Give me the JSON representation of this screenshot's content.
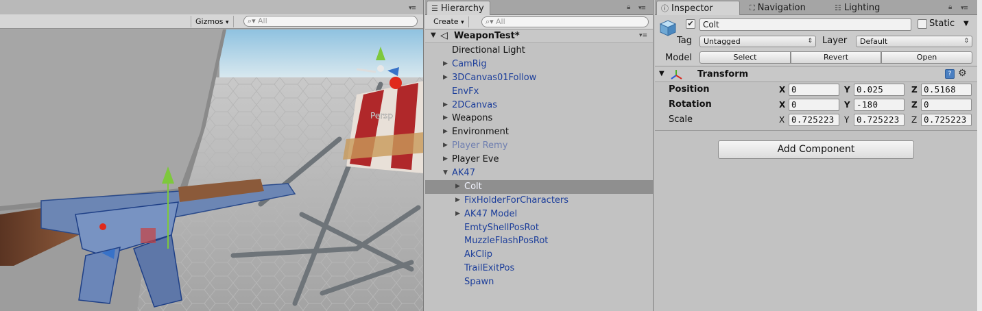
{
  "colors": {
    "panel_bg": "#c2c2c2",
    "selection": "#8f8f8f",
    "prefab_blue": "#1b3d9a",
    "disabled_prefab": "#6f7fb0"
  },
  "scene": {
    "gizmos_label": "Gizmos",
    "search_placeholder": "All",
    "camera_mode": "Persp"
  },
  "hierarchy": {
    "tab_label": "Hierarchy",
    "create_label": "Create",
    "search_placeholder": "All",
    "scene_name": "WeaponTest*",
    "items": [
      {
        "label": "Directional Light",
        "depth": 0,
        "fold": "none",
        "style": "normal"
      },
      {
        "label": "CamRig",
        "depth": 0,
        "fold": "collapsed",
        "style": "prefab"
      },
      {
        "label": "3DCanvas01Follow",
        "depth": 0,
        "fold": "collapsed",
        "style": "prefab"
      },
      {
        "label": "EnvFx",
        "depth": 0,
        "fold": "none",
        "style": "prefab"
      },
      {
        "label": "2DCanvas",
        "depth": 0,
        "fold": "collapsed",
        "style": "prefab"
      },
      {
        "label": "Weapons",
        "depth": 0,
        "fold": "collapsed",
        "style": "normal"
      },
      {
        "label": "Environment",
        "depth": 0,
        "fold": "collapsed",
        "style": "normal"
      },
      {
        "label": "Player Remy",
        "depth": 0,
        "fold": "collapsed",
        "style": "disabled"
      },
      {
        "label": "Player Eve",
        "depth": 0,
        "fold": "collapsed",
        "style": "normal"
      },
      {
        "label": "AK47",
        "depth": 0,
        "fold": "expanded",
        "style": "prefab"
      },
      {
        "label": "Colt",
        "depth": 1,
        "fold": "collapsed",
        "style": "prefab",
        "selected": true
      },
      {
        "label": "FixHolderForCharacters",
        "depth": 1,
        "fold": "collapsed",
        "style": "prefab"
      },
      {
        "label": "AK47 Model",
        "depth": 1,
        "fold": "collapsed",
        "style": "prefab"
      },
      {
        "label": "EmtyShellPosRot",
        "depth": 1,
        "fold": "none",
        "style": "prefab"
      },
      {
        "label": "MuzzleFlashPosRot",
        "depth": 1,
        "fold": "none",
        "style": "prefab"
      },
      {
        "label": "AkClip",
        "depth": 1,
        "fold": "none",
        "style": "prefab"
      },
      {
        "label": "TrailExitPos",
        "depth": 1,
        "fold": "none",
        "style": "prefab"
      },
      {
        "label": "Spawn",
        "depth": 1,
        "fold": "none",
        "style": "prefab"
      }
    ]
  },
  "inspector": {
    "tabs": [
      {
        "label": "Inspector",
        "icon": "info-icon"
      },
      {
        "label": "Navigation",
        "icon": "navigation-icon"
      },
      {
        "label": "Lighting",
        "icon": "lighting-icon"
      }
    ],
    "object_name": "Colt",
    "active_checked": true,
    "static_label": "Static",
    "tag_label": "Tag",
    "tag_value": "Untagged",
    "layer_label": "Layer",
    "layer_value": "Default",
    "model_label": "Model",
    "model_buttons": [
      "Select",
      "Revert",
      "Open"
    ],
    "component_title": "Transform",
    "position_label": "Position",
    "rotation_label": "Rotation",
    "scale_label": "Scale",
    "position": {
      "x": "0",
      "y": "0.025",
      "z": "0.5168"
    },
    "rotation": {
      "x": "0",
      "y": "-180",
      "z": "0"
    },
    "scale": {
      "x": "0.725223",
      "y": "0.725223",
      "z": "0.725223"
    },
    "add_component_label": "Add Component"
  }
}
